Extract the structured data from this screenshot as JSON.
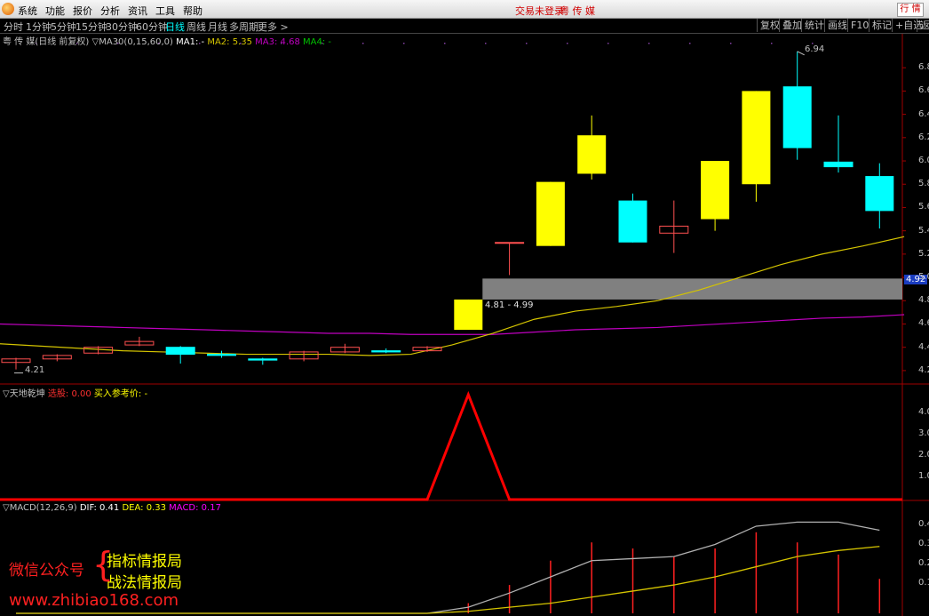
{
  "menubar": {
    "items": [
      "系统",
      "功能",
      "报价",
      "分析",
      "资讯",
      "工具",
      "帮助"
    ],
    "status_text": "交易未登录",
    "stock_title": "粤 传 媒",
    "right_button": "行 情"
  },
  "toolbar": {
    "periods": [
      "分时",
      "1分钟",
      "5分钟",
      "15分钟",
      "30分钟",
      "60分钟",
      "日线",
      "周线",
      "月线",
      "多周期",
      "更多 >"
    ],
    "active_period": "日线",
    "right_buttons": [
      "复权",
      "叠加",
      "统计",
      "画线",
      "F10",
      "标记",
      "+自选",
      "返回"
    ]
  },
  "main_panel": {
    "title": "粤 传 媒(日线 前复权)",
    "indicator_prefix": "▽MA30(0,15,60,0)",
    "ma1_label": "MA1: -",
    "ma2_label": "MA2: 5.35",
    "ma3_label": "MA3: 4.68",
    "ma4_label": "MA4: -",
    "high_marker": "6.94",
    "low_marker": "4.21",
    "zone_label": "4.81 - 4.99",
    "current_price": "4.92",
    "price_axis": [
      "6.8",
      "6.6",
      "6.4",
      "6.2",
      "6.0",
      "5.8",
      "5.6",
      "5.4",
      "5.2",
      "5.0",
      "4.8",
      "4.6",
      "4.4",
      "4.2"
    ]
  },
  "sub_panel": {
    "title": "▽天地乾坤",
    "item1": "选股: 0.00",
    "item2": "买入参考价: -",
    "axis": [
      "4.0",
      "3.0",
      "2.0",
      "1.0"
    ]
  },
  "macd_panel": {
    "title": "▽MACD(12,26,9)",
    "dif": "DIF: 0.41",
    "dea": "DEA: 0.33",
    "macd": "MACD: 0.17",
    "axis": [
      "0.4",
      "0.3",
      "0.2",
      "0.1"
    ]
  },
  "watermark": {
    "line1": "微信公众号",
    "line2a": "指标情报局",
    "line2b": "战法情报局",
    "url": "www.zhibiao168.com"
  },
  "colors": {
    "up": "#ffff00",
    "down": "#00ffff",
    "small_candle": "#ff5050",
    "ma2": "#d4c400",
    "ma3": "#c000c0",
    "signal": "#ff0000",
    "zone": "#808080"
  },
  "chart_data": {
    "type": "candlestick",
    "ylim": [
      4.1,
      7.0
    ],
    "candles": [
      {
        "o": 4.27,
        "c": 4.3,
        "h": 4.31,
        "l": 4.21
      },
      {
        "o": 4.3,
        "c": 4.33,
        "h": 4.34,
        "l": 4.28
      },
      {
        "o": 4.35,
        "c": 4.4,
        "h": 4.41,
        "l": 4.34
      },
      {
        "o": 4.42,
        "c": 4.45,
        "h": 4.49,
        "l": 4.41
      },
      {
        "o": 4.4,
        "c": 4.34,
        "h": 4.41,
        "l": 4.26
      },
      {
        "o": 4.34,
        "c": 4.33,
        "h": 4.37,
        "l": 4.31
      },
      {
        "o": 4.3,
        "c": 4.29,
        "h": 4.31,
        "l": 4.25
      },
      {
        "o": 4.3,
        "c": 4.36,
        "h": 4.37,
        "l": 4.28
      },
      {
        "o": 4.36,
        "c": 4.4,
        "h": 4.43,
        "l": 4.35
      },
      {
        "o": 4.37,
        "c": 4.36,
        "h": 4.39,
        "l": 4.35
      },
      {
        "o": 4.37,
        "c": 4.4,
        "h": 4.41,
        "l": 4.36
      },
      {
        "o": 4.55,
        "c": 4.81,
        "h": 4.81,
        "l": 4.55
      },
      {
        "o": 5.3,
        "c": 5.3,
        "h": 5.3,
        "l": 5.02
      },
      {
        "o": 5.27,
        "c": 5.82,
        "h": 5.82,
        "l": 5.27
      },
      {
        "o": 5.89,
        "c": 6.22,
        "h": 6.39,
        "l": 5.84
      },
      {
        "o": 5.66,
        "c": 5.3,
        "h": 5.72,
        "l": 5.3
      },
      {
        "o": 5.38,
        "c": 5.44,
        "h": 5.66,
        "l": 5.21
      },
      {
        "o": 5.5,
        "c": 6.0,
        "h": 6.0,
        "l": 5.4
      },
      {
        "o": 5.8,
        "c": 6.6,
        "h": 6.6,
        "l": 5.65
      },
      {
        "o": 6.64,
        "c": 6.11,
        "h": 6.94,
        "l": 6.01
      },
      {
        "o": 5.99,
        "c": 5.95,
        "h": 6.39,
        "l": 5.9
      },
      {
        "o": 5.87,
        "c": 5.57,
        "h": 5.98,
        "l": 5.42
      }
    ],
    "ma2": [
      4.43,
      4.41,
      4.39,
      4.37,
      4.36,
      4.35,
      4.34,
      4.34,
      4.34,
      4.33,
      4.34,
      4.42,
      4.52,
      4.64,
      4.71,
      4.75,
      4.8,
      4.89,
      5.0,
      5.11,
      5.2,
      5.27,
      5.35
    ],
    "ma3": [
      4.6,
      4.59,
      4.58,
      4.57,
      4.56,
      4.55,
      4.54,
      4.53,
      4.52,
      4.52,
      4.51,
      4.51,
      4.51,
      4.53,
      4.55,
      4.56,
      4.57,
      4.59,
      4.61,
      4.63,
      4.65,
      4.66,
      4.68
    ],
    "zone": [
      4.81,
      4.99
    ],
    "signal": [
      0,
      0,
      0,
      0,
      0,
      0,
      0,
      0,
      0,
      0,
      0,
      5,
      0,
      0,
      0,
      0,
      0,
      0,
      0,
      0,
      0,
      0
    ],
    "dif": [
      0.0,
      0.0,
      0.0,
      0.0,
      0.0,
      0.0,
      0.0,
      0.0,
      0.0,
      0.0,
      0.0,
      0.03,
      0.1,
      0.18,
      0.26,
      0.27,
      0.28,
      0.34,
      0.43,
      0.45,
      0.45,
      0.41
    ],
    "dea": [
      0.0,
      0.0,
      0.0,
      0.0,
      0.0,
      0.0,
      0.0,
      0.0,
      0.0,
      0.0,
      0.0,
      0.01,
      0.03,
      0.05,
      0.08,
      0.11,
      0.14,
      0.18,
      0.23,
      0.28,
      0.31,
      0.33
    ],
    "macd": [
      0,
      0,
      0,
      0,
      0,
      0,
      0,
      0,
      0,
      0,
      0,
      0.05,
      0.14,
      0.26,
      0.35,
      0.32,
      0.28,
      0.32,
      0.4,
      0.35,
      0.29,
      0.17
    ]
  }
}
